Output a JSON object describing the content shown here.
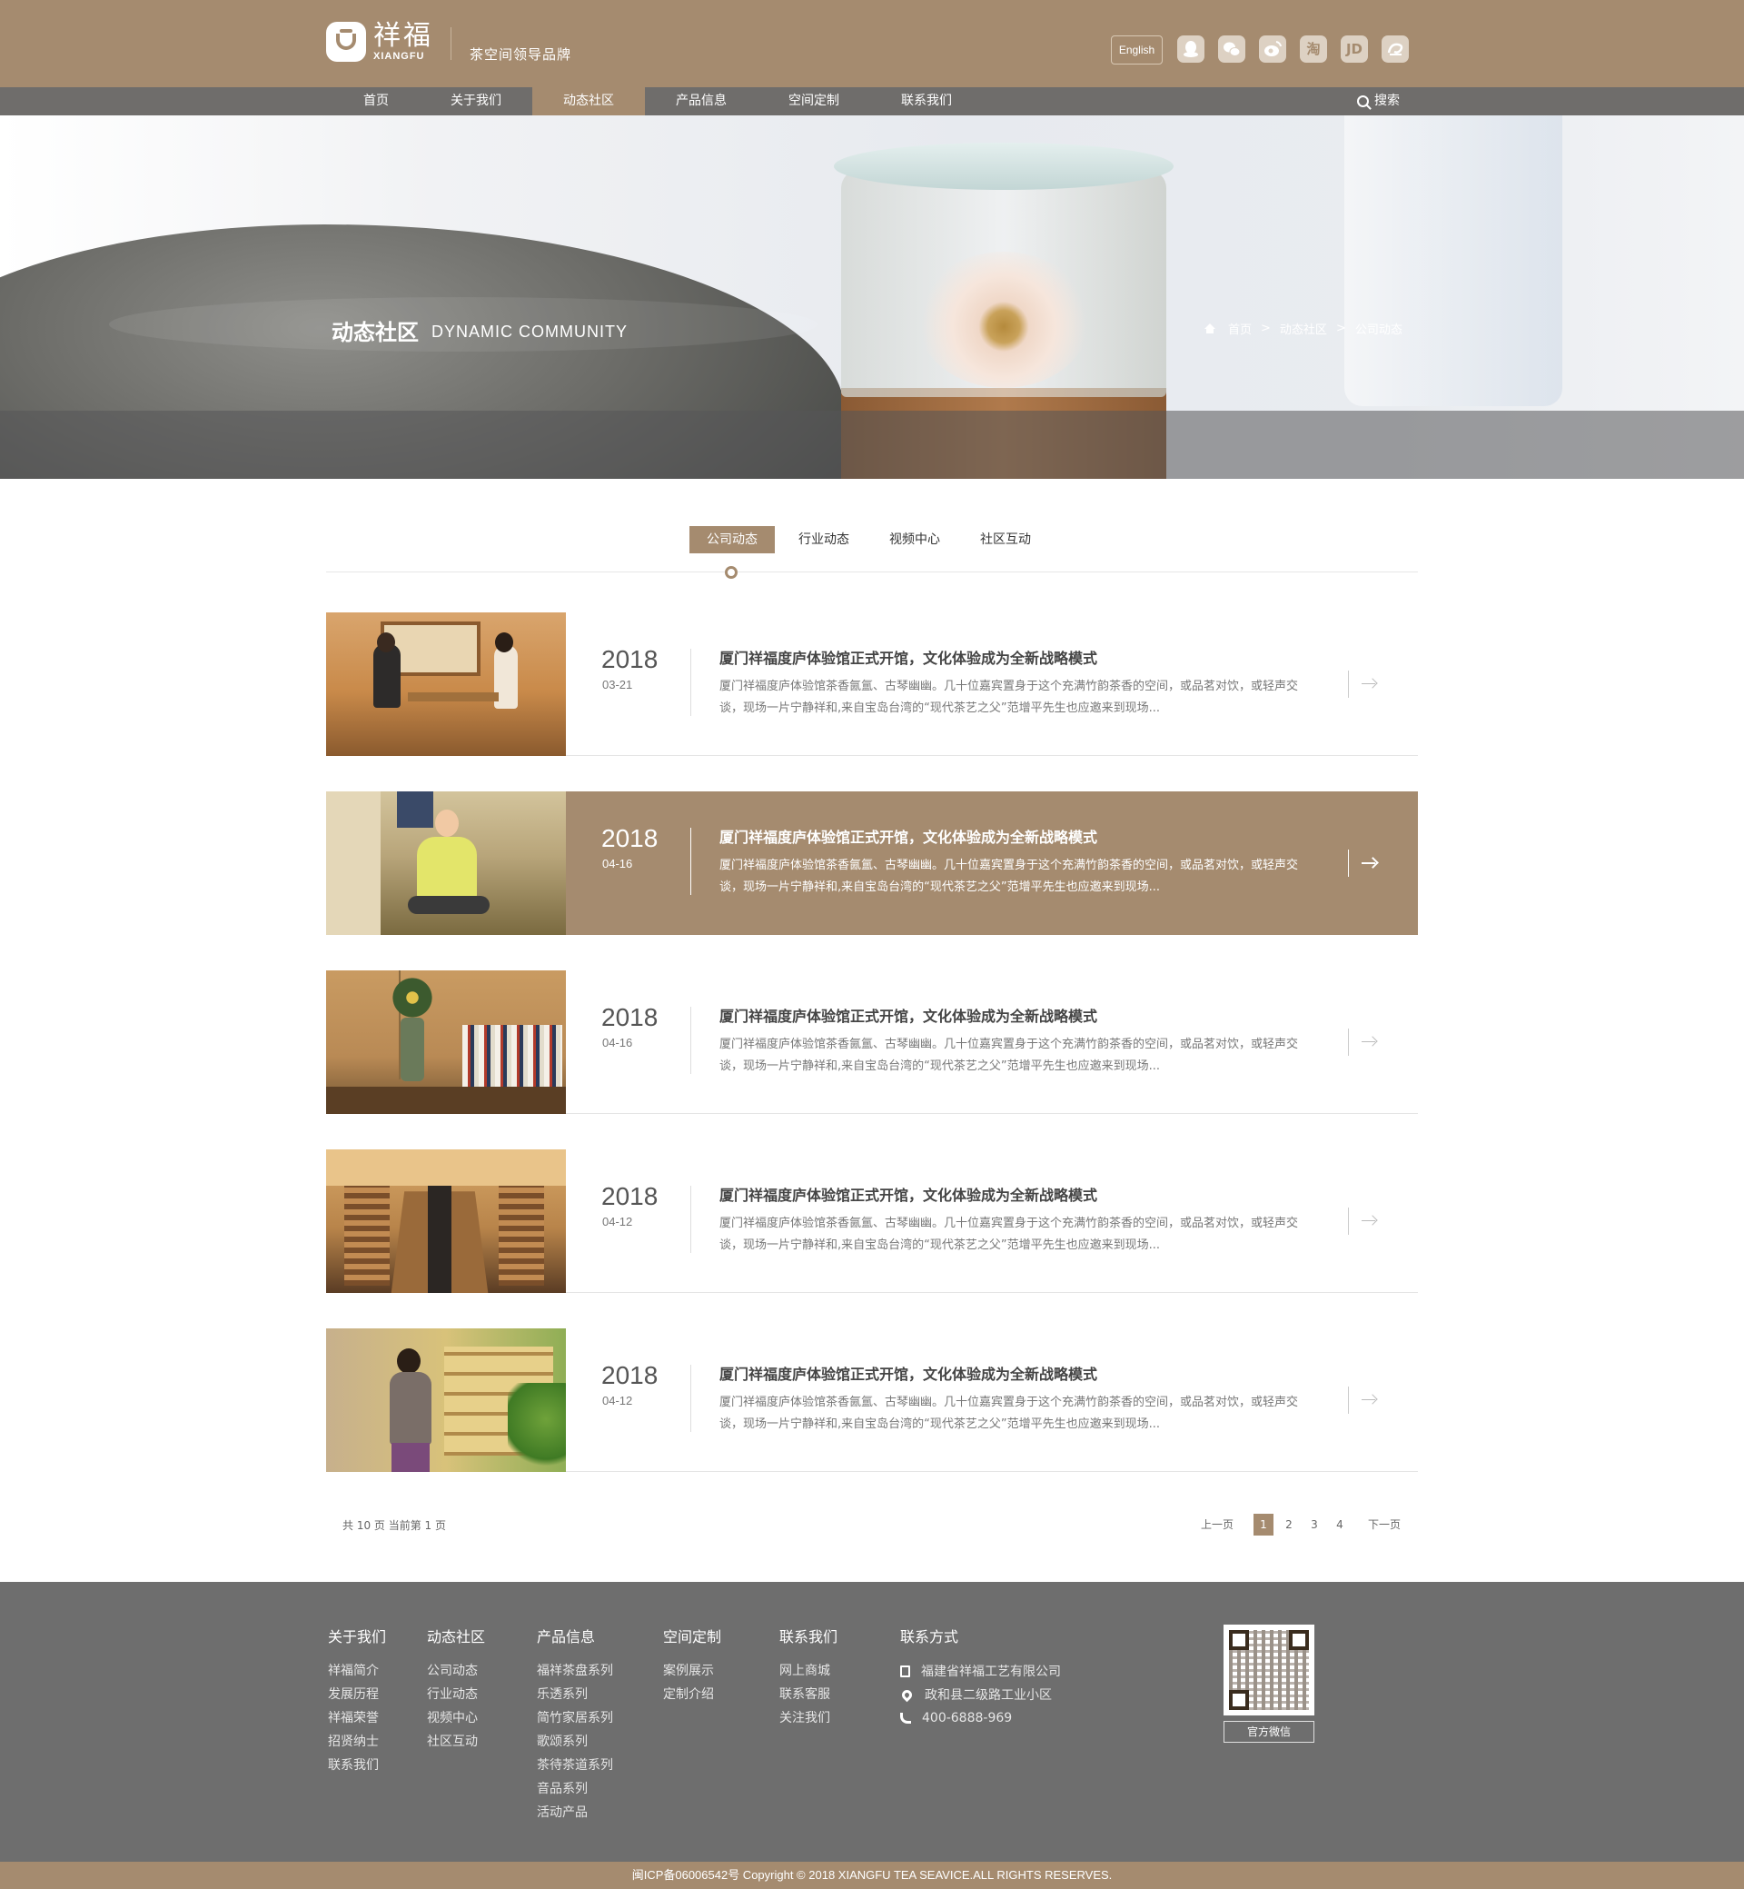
{
  "header": {
    "logo_cn": "祥福",
    "logo_en": "XIANGFU",
    "slogan": "茶空间领导品牌",
    "lang_label": "English",
    "social_icons": [
      "qq-icon",
      "wechat-icon",
      "weibo-icon",
      "taobao-icon",
      "jd-icon",
      "link-icon"
    ],
    "social_glyphs": [
      "",
      "",
      "",
      "淘",
      "JD",
      ""
    ]
  },
  "nav": {
    "items": [
      "首页",
      "关于我们",
      "动态社区",
      "产品信息",
      "空间定制",
      "联系我们"
    ],
    "active_index": 2,
    "search_label": "搜索"
  },
  "banner": {
    "title": "动态社区",
    "subtitle": "DYNAMIC COMMUNITY",
    "breadcrumb": [
      "首页",
      "动态社区",
      "公司动态"
    ],
    "separator": ">"
  },
  "tabs": {
    "items": [
      "公司动态",
      "行业动态",
      "视频中心",
      "社区互动"
    ],
    "active_index": 0
  },
  "news": [
    {
      "year": "2018",
      "date": "03-21",
      "title": "厦门祥福度庐体验馆正式开馆，文化体验成为全新战略模式",
      "desc": "厦门祥福度庐体验馆茶香氤氲、古琴幽幽。几十位嘉宾置身于这个充满竹韵茶香的空间，或品茗对饮，或轻声交谈，现场一片宁静祥和,来自宝岛台湾的“现代茶艺之父”范增平先生也应邀来到现场..."
    },
    {
      "year": "2018",
      "date": "04-16",
      "title": "厦门祥福度庐体验馆正式开馆，文化体验成为全新战略模式",
      "desc": "厦门祥福度庐体验馆茶香氤氲、古琴幽幽。几十位嘉宾置身于这个充满竹韵茶香的空间，或品茗对饮，或轻声交谈，现场一片宁静祥和,来自宝岛台湾的“现代茶艺之父”范增平先生也应邀来到现场..."
    },
    {
      "year": "2018",
      "date": "04-16",
      "title": "厦门祥福度庐体验馆正式开馆，文化体验成为全新战略模式",
      "desc": "厦门祥福度庐体验馆茶香氤氲、古琴幽幽。几十位嘉宾置身于这个充满竹韵茶香的空间，或品茗对饮，或轻声交谈，现场一片宁静祥和,来自宝岛台湾的“现代茶艺之父”范增平先生也应邀来到现场..."
    },
    {
      "year": "2018",
      "date": "04-12",
      "title": "厦门祥福度庐体验馆正式开馆，文化体验成为全新战略模式",
      "desc": "厦门祥福度庐体验馆茶香氤氲、古琴幽幽。几十位嘉宾置身于这个充满竹韵茶香的空间，或品茗对饮，或轻声交谈，现场一片宁静祥和,来自宝岛台湾的“现代茶艺之父”范增平先生也应邀来到现场..."
    },
    {
      "year": "2018",
      "date": "04-12",
      "title": "厦门祥福度庐体验馆正式开馆，文化体验成为全新战略模式",
      "desc": "厦门祥福度庐体验馆茶香氤氲、古琴幽幽。几十位嘉宾置身于这个充满竹韵茶香的空间，或品茗对饮，或轻声交谈，现场一片宁静祥和,来自宝岛台湾的“现代茶艺之父”范增平先生也应邀来到现场..."
    }
  ],
  "news_active_index": 1,
  "pager": {
    "info": "共 10 页  当前第 1 页",
    "prev": "上一页",
    "pages": [
      "1",
      "2",
      "3",
      "4"
    ],
    "current": "1",
    "next": "下一页"
  },
  "footer": {
    "columns": [
      {
        "title": "关于我们",
        "links": [
          "祥福简介",
          "发展历程",
          "祥福荣誉",
          "招贤纳士",
          "联系我们"
        ]
      },
      {
        "title": "动态社区",
        "links": [
          "公司动态",
          "行业动态",
          "视频中心",
          "社区互动"
        ]
      },
      {
        "title": "产品信息",
        "links": [
          "福祥茶盘系列",
          "乐透系列",
          "简竹家居系列",
          "歌颂系列",
          "茶待茶道系列",
          "音品系列",
          "活动产品"
        ]
      },
      {
        "title": "空间定制",
        "links": [
          "案例展示",
          "定制介绍"
        ]
      },
      {
        "title": "联系我们",
        "links": [
          "网上商城",
          "联系客服",
          "关注我们"
        ]
      }
    ],
    "contact_title": "联系方式",
    "contact": [
      {
        "icon": "building-icon",
        "text": "福建省祥福工艺有限公司"
      },
      {
        "icon": "location-pin-icon",
        "text": "政和县二级路工业小区"
      },
      {
        "icon": "phone-icon",
        "text": "400-6888-969"
      }
    ],
    "qr_label": "官方微信",
    "copyright": "闽ICP备06006542号 Copyright © 2018 XIANGFU TEA SEAVICE.ALL RIGHTS RESERVES."
  },
  "colors": {
    "brand": "#a58b6f",
    "nav_bg": "#6f6d6b",
    "footer_bg": "#6e6e6e"
  }
}
